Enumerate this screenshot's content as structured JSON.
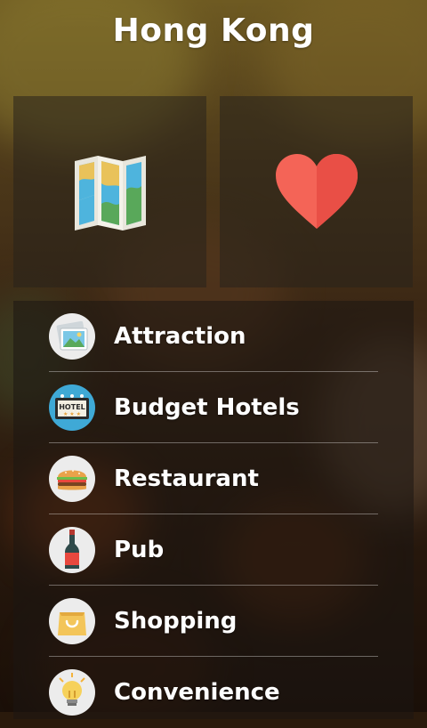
{
  "header": {
    "title": "Hong Kong"
  },
  "tiles": [
    {
      "icon": "map-icon"
    },
    {
      "icon": "heart-icon",
      "color": "#f15552"
    }
  ],
  "menu": [
    {
      "label": "Attraction",
      "icon": "photo-icon"
    },
    {
      "label": "Budget Hotels",
      "icon": "hotel-icon",
      "hotel_text": "HOTEL"
    },
    {
      "label": "Restaurant",
      "icon": "burger-icon"
    },
    {
      "label": "Pub",
      "icon": "bottle-icon"
    },
    {
      "label": "Shopping",
      "icon": "shopping-bag-icon"
    },
    {
      "label": "Convenience",
      "icon": "lightbulb-icon"
    }
  ],
  "colors": {
    "icon_circle": "#ececec",
    "hotel_blue": "#3fa9d6",
    "bag_yellow": "#f3c55a"
  }
}
